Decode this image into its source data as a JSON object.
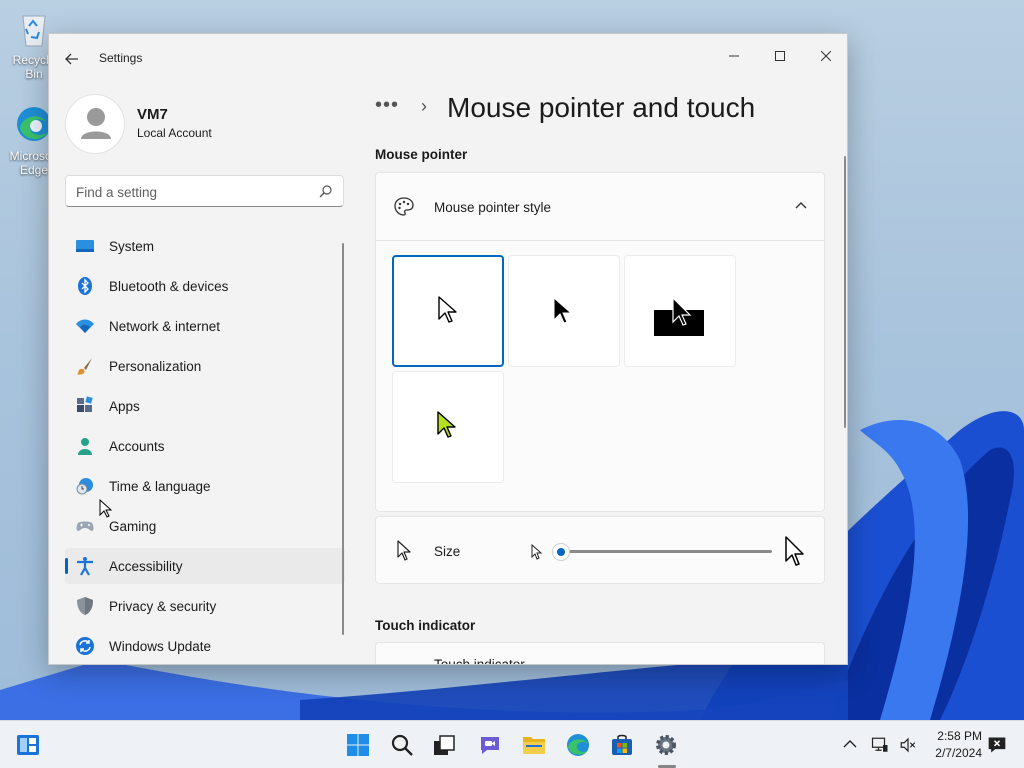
{
  "desktop": {
    "icons": [
      {
        "label": "Recycle Bin"
      },
      {
        "label": "Microsoft Edge"
      }
    ]
  },
  "window": {
    "title": "Settings",
    "back_icon": "arrow-left-icon",
    "controls": [
      "minimize",
      "maximize",
      "close"
    ]
  },
  "profile": {
    "name": "VM7",
    "account_type": "Local Account"
  },
  "search": {
    "placeholder": "Find a setting",
    "value": ""
  },
  "nav": {
    "items": [
      {
        "label": "System",
        "icon": "system-icon"
      },
      {
        "label": "Bluetooth & devices",
        "icon": "bluetooth-icon"
      },
      {
        "label": "Network & internet",
        "icon": "wifi-icon"
      },
      {
        "label": "Personalization",
        "icon": "brush-icon"
      },
      {
        "label": "Apps",
        "icon": "apps-icon"
      },
      {
        "label": "Accounts",
        "icon": "person-icon"
      },
      {
        "label": "Time & language",
        "icon": "globe-clock-icon"
      },
      {
        "label": "Gaming",
        "icon": "gamepad-icon"
      },
      {
        "label": "Accessibility",
        "icon": "accessibility-icon",
        "active": true
      },
      {
        "label": "Privacy & security",
        "icon": "shield-icon"
      },
      {
        "label": "Windows Update",
        "icon": "update-icon"
      }
    ]
  },
  "page": {
    "breadcrumb_more": "•••",
    "breadcrumb_sep": "›",
    "title": "Mouse pointer and touch"
  },
  "mouse_pointer": {
    "section_label": "Mouse pointer",
    "style": {
      "label": "Mouse pointer style",
      "expanded": true,
      "options": [
        {
          "name": "white",
          "selected": true
        },
        {
          "name": "black",
          "selected": false
        },
        {
          "name": "inverted",
          "selected": false
        },
        {
          "name": "custom",
          "selected": false,
          "color": "#b4e01e"
        }
      ]
    },
    "size": {
      "label": "Size",
      "value": 1,
      "min": 1,
      "max": 15
    }
  },
  "touch_indicator": {
    "section_label": "Touch indicator",
    "card_label": "Touch indicator"
  },
  "taskbar": {
    "items": [
      "widgets",
      "start",
      "search",
      "task-view",
      "chat",
      "file-explorer",
      "edge",
      "store",
      "settings"
    ],
    "active": "settings",
    "time": "2:58 PM",
    "date": "2/7/2024"
  },
  "colors": {
    "accent": "#0067c0",
    "window_bg": "#f3f3f3",
    "card_bg": "#fbfbfb"
  }
}
